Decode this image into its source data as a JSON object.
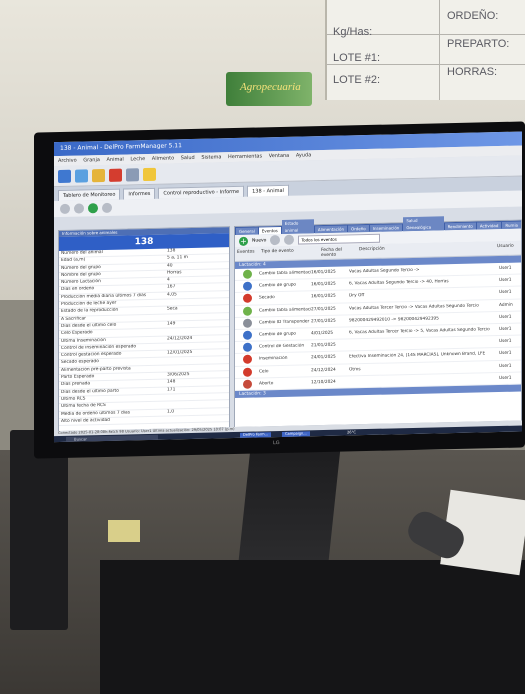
{
  "whiteboard": {
    "kg_label": "Kg/Has:",
    "ordeno": "ORDEÑO:",
    "lote1": "LOTE #1:",
    "preparto": "PREPARTO:",
    "lote2": "LOTE #2:",
    "horras": "HORRAS:"
  },
  "poster": {
    "text": "Agropecuaria"
  },
  "app": {
    "title": "138 - Animal - DelPro FarmManager 5.11",
    "menu": [
      "Archivo",
      "Granja",
      "Animal",
      "Leche",
      "Alimento",
      "Salud",
      "Sistema",
      "Herramientas",
      "Ventana",
      "Ayuda"
    ],
    "tabs": [
      "Tablero de Monitoreo",
      "Informes",
      "Control reproductivo - Informe",
      "138 - Animal"
    ],
    "left_panel": {
      "header": "Información sobre animales",
      "animal_number": "138",
      "rows": [
        {
          "k": "Número del animal",
          "v": "138"
        },
        {
          "k": "Edad (a,m)",
          "v": "5 a, 11 m"
        },
        {
          "k": "Número del grupo",
          "v": "40"
        },
        {
          "k": "Nombre del grupo",
          "v": "Horras"
        },
        {
          "k": "Número Lactación",
          "v": "4"
        },
        {
          "k": "Días en ordeño",
          "v": "167"
        },
        {
          "k": "Producción media diaria últimos 7 días",
          "v": "4,05"
        },
        {
          "k": "Producción de leche ayer",
          "v": ""
        },
        {
          "k": "Estado de la reproducción",
          "v": "Seca"
        },
        {
          "k": "A Sacrificar",
          "v": ""
        },
        {
          "k": "Días desde el último celo",
          "v": "149"
        },
        {
          "k": "Celo Esperado",
          "v": ""
        },
        {
          "k": "Última Inseminación",
          "v": "24/12/2024"
        },
        {
          "k": "Control de inseminación esperado",
          "v": ""
        },
        {
          "k": "Control gestación esperado",
          "v": "12/01/2025"
        },
        {
          "k": "Secado esperado",
          "v": ""
        },
        {
          "k": "Alimentación pre-parto prevista",
          "v": ""
        },
        {
          "k": "Parto Esperado",
          "v": "3/06/2025"
        },
        {
          "k": "Días preñada",
          "v": "148"
        },
        {
          "k": "Días desde el último parto",
          "v": "171"
        },
        {
          "k": "Último RCS",
          "v": ""
        },
        {
          "k": "Última fecha de RCS",
          "v": ""
        },
        {
          "k": "Media de ordeño últimos 7 días",
          "v": "1,0"
        },
        {
          "k": "Alto nivel de actividad",
          "v": ""
        }
      ]
    },
    "right_panel": {
      "tabs": [
        "General",
        "Eventos",
        "Estado animal",
        "Alimentación",
        "Ordeño",
        "Inseminación",
        "Salud Genealógica",
        "Rendimiento",
        "Actividad",
        "Rumia"
      ],
      "new_button": "Nuevo",
      "filter": "Todos los eventos",
      "columns": [
        "Eventos",
        "Tipo de evento",
        "Fecha del evento",
        "Descripción",
        "Usuario"
      ],
      "group": "Lactación: 4",
      "events": [
        {
          "ev": "Cambio tabla alimentación",
          "fe": "16/01/2025",
          "de": "Vacas Adultas Segundo Tercio -> ",
          "us": "User1",
          "c": "#6fb24a"
        },
        {
          "ev": "Cambio de grupo",
          "fe": "16/01/2025",
          "de": "6, Vacas Adultas Segundo Tercio -> 40, Horras",
          "us": "User1",
          "c": "#3d71c8"
        },
        {
          "ev": "Secado",
          "fe": "16/01/2025",
          "de": "Dry Off",
          "us": "User1",
          "c": "#d33b2c"
        },
        {
          "ev": "Cambio tabla alimentación",
          "fe": "27/01/2025",
          "de": "Vacas Adultas Tercer Tercio -> Vacas Adultas Segundo Tercio",
          "us": "Admin",
          "c": "#6fb24a"
        },
        {
          "ev": "Cambio ID Transponder",
          "fe": "27/01/2025",
          "de": "982000429492010 -> 982000429492395",
          "us": "User1",
          "c": "#8a8f99"
        },
        {
          "ev": "Cambio de grupo",
          "fe": "4/01/2025",
          "de": "6, Vacas Adultas Tercer Tercio -> 5, Vacas Adultas Segundo Tercio",
          "us": "User1",
          "c": "#3d71c8"
        },
        {
          "ev": "Control de Gestación",
          "fe": "21/01/2025",
          "de": "",
          "us": "User1",
          "c": "#3d71c8"
        },
        {
          "ev": "Inseminación",
          "fe": "24/01/2025",
          "de": "Efectiva Inseminación 24, [14S MARCIAS], Unknown Brand, LFE",
          "us": "User1",
          "c": "#d33b2c"
        },
        {
          "ev": "Celo",
          "fe": "24/12/2024",
          "de": "Otros",
          "us": "User1",
          "c": "#d33b2c"
        },
        {
          "ev": "Aborto",
          "fe": "12/10/2024",
          "de": "",
          "us": "User1",
          "c": "#c64a3a"
        }
      ],
      "last_group": "Lactación: 3"
    },
    "status": "Conectado  2025-01-28:08h:Fatch 98  Usuario: User1  Última actualización: 29/05/2025 10:07 (p.m)",
    "taskbar": {
      "search": "Buscar",
      "btn1": "DelPro Farm...",
      "btn2": "Campaign...",
      "weather": "26°C"
    }
  },
  "monitor_brand": "LG"
}
